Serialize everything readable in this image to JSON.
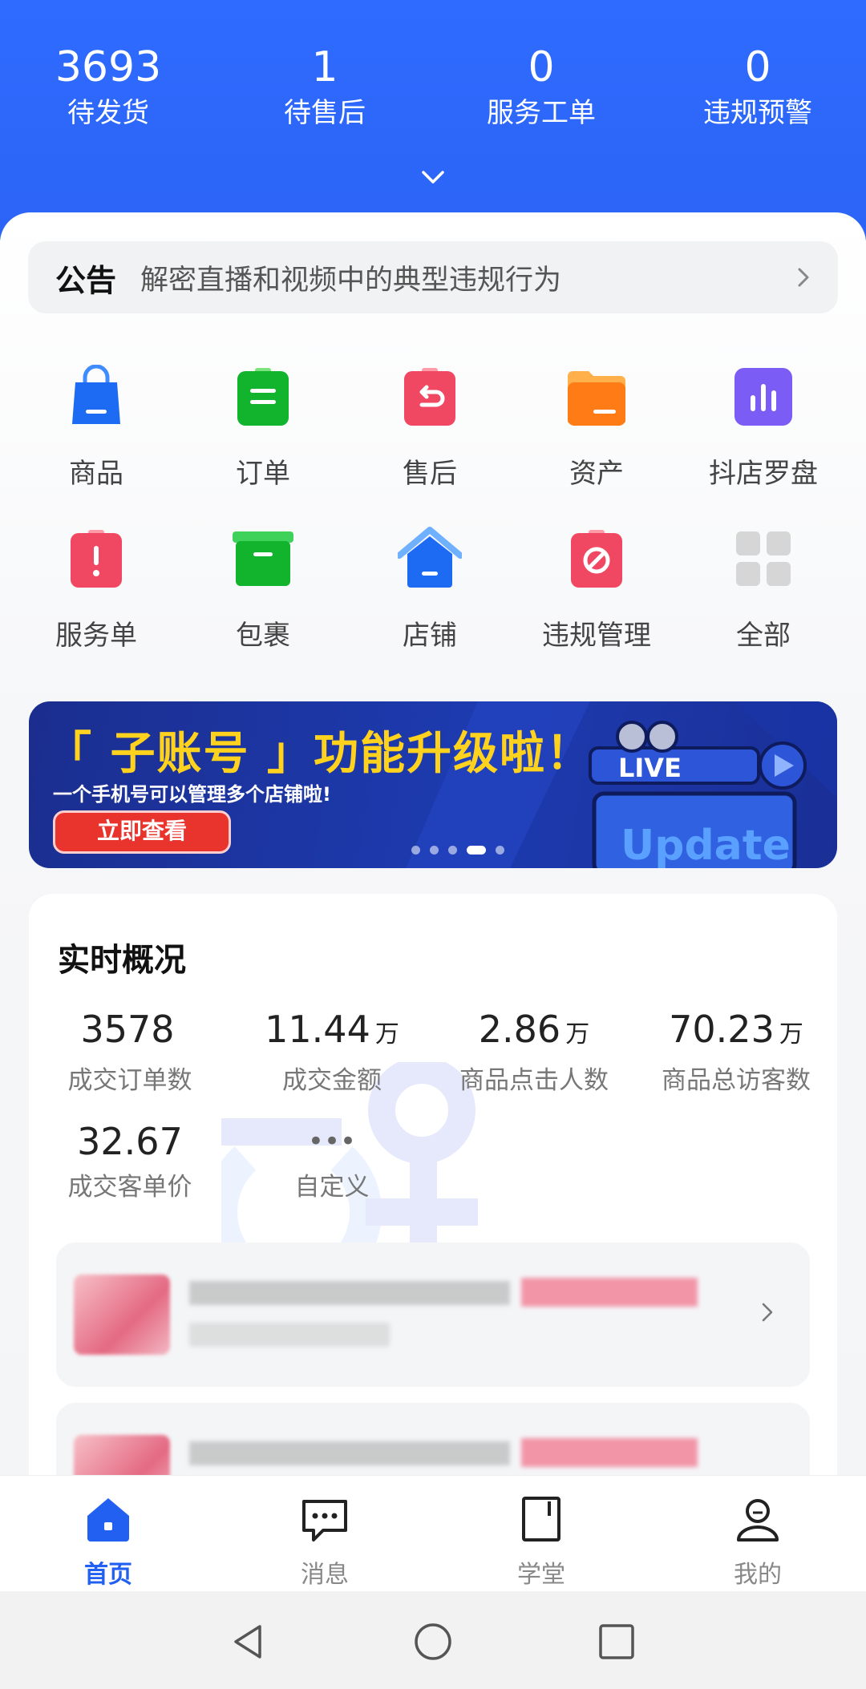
{
  "header": {
    "stats": [
      {
        "value": "3693",
        "label": "待发货"
      },
      {
        "value": "1",
        "label": "待售后"
      },
      {
        "value": "0",
        "label": "服务工单"
      },
      {
        "value": "0",
        "label": "违规预警"
      }
    ]
  },
  "notice": {
    "tag": "公告",
    "text": "解密直播和视频中的典型违规行为"
  },
  "grid": {
    "items": [
      {
        "label": "商品",
        "icon": "shopping-bag-icon"
      },
      {
        "label": "订单",
        "icon": "order-icon"
      },
      {
        "label": "售后",
        "icon": "return-icon"
      },
      {
        "label": "资产",
        "icon": "wallet-icon"
      },
      {
        "label": "抖店罗盘",
        "icon": "chart-icon"
      },
      {
        "label": "服务单",
        "icon": "alert-icon"
      },
      {
        "label": "包裹",
        "icon": "package-icon"
      },
      {
        "label": "店铺",
        "icon": "store-icon"
      },
      {
        "label": "违规管理",
        "icon": "forbidden-icon"
      },
      {
        "label": "全部",
        "icon": "all-apps-icon"
      }
    ]
  },
  "banner": {
    "title": "「 子账号 」功能升级啦！",
    "subtitle": "一个手机号可以管理多个店铺啦!",
    "button": "立即查看",
    "live_text": "LIVE",
    "update_text": "Update"
  },
  "realtime": {
    "title": "实时概况",
    "metrics": [
      {
        "value": "3578",
        "unit": "",
        "label": "成交订单数"
      },
      {
        "value": "11.44",
        "unit": "万",
        "label": "成交金额"
      },
      {
        "value": "2.86",
        "unit": "万",
        "label": "商品点击人数"
      },
      {
        "value": "70.23",
        "unit": "万",
        "label": "商品总访客数"
      },
      {
        "value": "32.67",
        "unit": "",
        "label": "成交客单价"
      },
      {
        "value": "•••",
        "unit": "",
        "label": "自定义"
      }
    ]
  },
  "tabbar": {
    "items": [
      {
        "label": "首页"
      },
      {
        "label": "消息"
      },
      {
        "label": "学堂"
      },
      {
        "label": "我的"
      }
    ]
  },
  "colors": {
    "primary": "#2b64f6",
    "banner_title": "#ffd21e",
    "active_tab": "#2160f0"
  }
}
